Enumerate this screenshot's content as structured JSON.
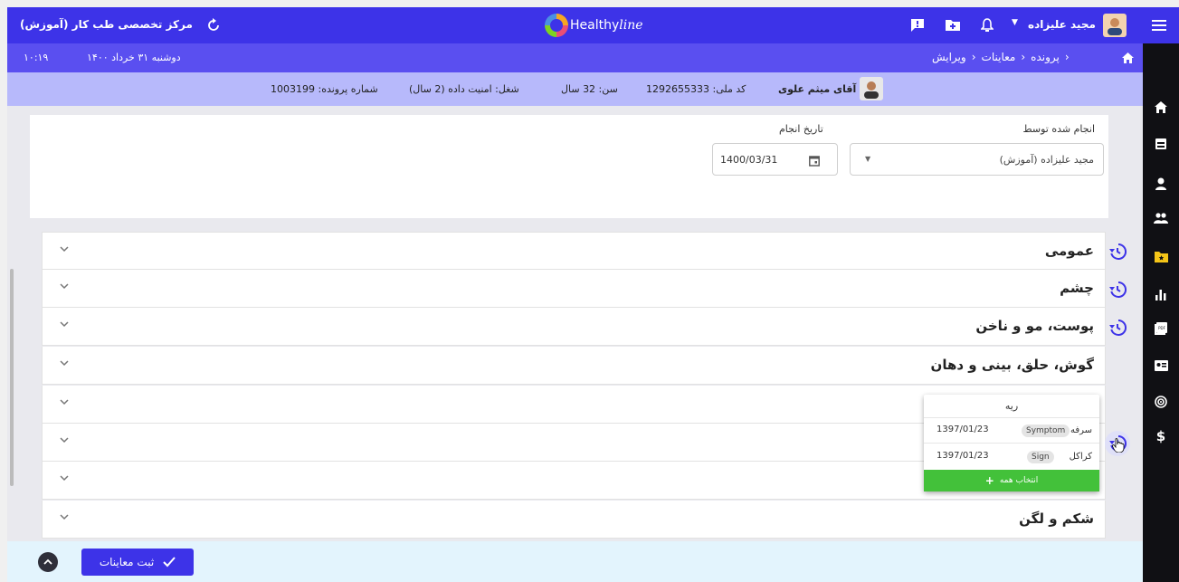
{
  "topbar": {
    "clinic_name": "مرکز تخصصی طب کار (آموزش)",
    "logo_text": "Healthy",
    "logo_script": "line",
    "user_name": "مجید علیزاده",
    "icons": [
      "refresh-icon",
      "message-icon",
      "folder-add-icon",
      "bell-icon",
      "menu-icon"
    ]
  },
  "subbar": {
    "date": "دوشنبه ۳۱ خرداد ۱۴۰۰",
    "time": "۱۰:۱۹",
    "breadcrumb": [
      "پرونده",
      "معاینات",
      "ویرایش"
    ]
  },
  "patient": {
    "name": "آقای میثم علوی",
    "national_id": "کد ملی: 1292655333",
    "age": "سن: 32 سال",
    "job": "شغل: امنیت داده (2 سال)",
    "file_number": "شماره پرونده: 1003199"
  },
  "form": {
    "performed_by_label": "انجام شده توسط",
    "performed_by_value": "مجید علیزاده (آموزش)",
    "date_label": "تاریخ انجام",
    "date_value": "1400/03/31"
  },
  "sections": [
    {
      "title": "عمومی",
      "history": true
    },
    {
      "title": "چشم",
      "history": true
    },
    {
      "title": "پوست، مو و ناخن",
      "history": true
    },
    {
      "title": "گوش، حلق، بینی و دهان",
      "history": false
    },
    {
      "title": "",
      "history": false
    },
    {
      "title": "",
      "history": true
    },
    {
      "title": "",
      "history": false
    },
    {
      "title": "شکم و لگن",
      "history": false
    }
  ],
  "popup": {
    "title": "ریه",
    "rows": [
      {
        "name": "سرفه",
        "tag": "Symptom",
        "date": "1397/01/23"
      },
      {
        "name": "کراکل",
        "tag": "Sign",
        "date": "1397/01/23"
      }
    ],
    "select_all": "انتخاب همه"
  },
  "footer": {
    "submit_label": "ثبت معاینات"
  },
  "sidenav": {
    "icons": [
      "home-icon",
      "inbox-icon",
      "person-icon",
      "people-icon",
      "folder-star-icon",
      "bar-chart-icon",
      "pdf-icon",
      "id-card-icon",
      "radar-icon",
      "dollar-icon"
    ]
  },
  "colors": {
    "primary": "#3d33e8",
    "subbar": "#5a4ff0",
    "patient_bar": "#b7b9fb",
    "sidenav": "#101014",
    "success": "#43c13a",
    "footer_bg": "#e3f4fd"
  }
}
